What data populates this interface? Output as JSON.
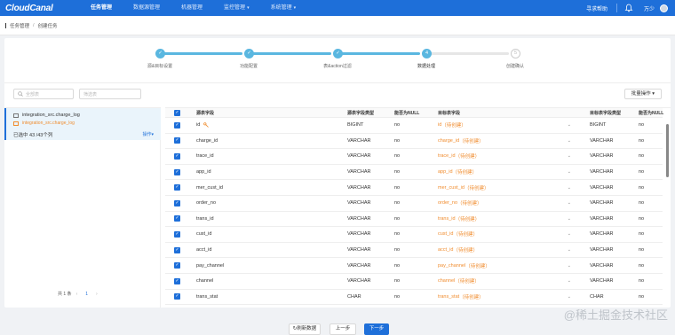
{
  "app": {
    "logo": "CloudCanal"
  },
  "nav": {
    "items": [
      {
        "label": "任务管理",
        "active": true
      },
      {
        "label": "数据源管理",
        "active": false
      },
      {
        "label": "机器管理",
        "active": false
      },
      {
        "label": "监控管理",
        "active": false,
        "caret": "▾"
      },
      {
        "label": "系统管理",
        "active": false,
        "caret": "▾"
      }
    ],
    "help": "寻求帮助",
    "user": "万少"
  },
  "breadcrumb": {
    "parent": "任务管理",
    "sep": "/",
    "current": "创建任务"
  },
  "steps": [
    {
      "num": "✓",
      "label": "源&目标设置",
      "done": true
    },
    {
      "num": "✓",
      "label": "功能配置",
      "done": true
    },
    {
      "num": "✓",
      "label": "表&action过滤",
      "done": true
    },
    {
      "num": "4",
      "label": "数据处理",
      "done": true,
      "current": true
    },
    {
      "num": "5",
      "label": "创建确认",
      "done": false
    }
  ],
  "toolbar": {
    "filter_placeholder": "全部表",
    "search_placeholder": "筛选表",
    "batch_label": "批量操作",
    "batch_caret": "▾"
  },
  "left": {
    "source_table": "integration_src.charge_log",
    "target_table": "integration_src.charge_log",
    "selected": "已选中 43 /43个列",
    "ops": "操作",
    "ops_caret": "▾",
    "pager_total": "共 1 条",
    "pager_prev": "‹",
    "pager_page": "1",
    "pager_next": "›"
  },
  "grid": {
    "headers": {
      "src_field": "源表字段",
      "src_type": "源表字段类型",
      "nullable": "能否为NULL",
      "tgt_field": "目标表字段",
      "tgt_type": "目标表字段类型",
      "tgt_nullable": "能否为NULL"
    },
    "pending_suffix": "（待创建）",
    "rows": [
      {
        "src": "id",
        "src_type": "BIGINT",
        "null": "no",
        "tgt": "id",
        "tgt_type": "BIGINT",
        "tgt_null": "no",
        "key": true
      },
      {
        "src": "charge_id",
        "src_type": "VARCHAR",
        "null": "no",
        "tgt": "charge_id",
        "tgt_type": "VARCHAR",
        "tgt_null": "no"
      },
      {
        "src": "trace_id",
        "src_type": "VARCHAR",
        "null": "no",
        "tgt": "trace_id",
        "tgt_type": "VARCHAR",
        "tgt_null": "no"
      },
      {
        "src": "app_id",
        "src_type": "VARCHAR",
        "null": "no",
        "tgt": "app_id",
        "tgt_type": "VARCHAR",
        "tgt_null": "no"
      },
      {
        "src": "mer_cust_id",
        "src_type": "VARCHAR",
        "null": "no",
        "tgt": "mer_cust_id",
        "tgt_type": "VARCHAR",
        "tgt_null": "no"
      },
      {
        "src": "order_no",
        "src_type": "VARCHAR",
        "null": "no",
        "tgt": "order_no",
        "tgt_type": "VARCHAR",
        "tgt_null": "no"
      },
      {
        "src": "trans_id",
        "src_type": "VARCHAR",
        "null": "no",
        "tgt": "trans_id",
        "tgt_type": "VARCHAR",
        "tgt_null": "no"
      },
      {
        "src": "cust_id",
        "src_type": "VARCHAR",
        "null": "no",
        "tgt": "cust_id",
        "tgt_type": "VARCHAR",
        "tgt_null": "no"
      },
      {
        "src": "acct_id",
        "src_type": "VARCHAR",
        "null": "no",
        "tgt": "acct_id",
        "tgt_type": "VARCHAR",
        "tgt_null": "no"
      },
      {
        "src": "pay_channel",
        "src_type": "VARCHAR",
        "null": "no",
        "tgt": "pay_channel",
        "tgt_type": "VARCHAR",
        "tgt_null": "no"
      },
      {
        "src": "channel",
        "src_type": "VARCHAR",
        "null": "no",
        "tgt": "channel",
        "tgt_type": "VARCHAR",
        "tgt_null": "no"
      },
      {
        "src": "trans_stat",
        "src_type": "CHAR",
        "null": "no",
        "tgt": "trans_stat",
        "tgt_type": "CHAR",
        "tgt_null": "no"
      }
    ]
  },
  "footer": {
    "refresh": "↻刷新数据",
    "prev": "上一步",
    "next": "下一步"
  },
  "watermark": "@稀土掘金技术社区",
  "colors": {
    "brand": "#1e6fd9",
    "step": "#5ab7e0",
    "pending": "#f08c2e"
  }
}
